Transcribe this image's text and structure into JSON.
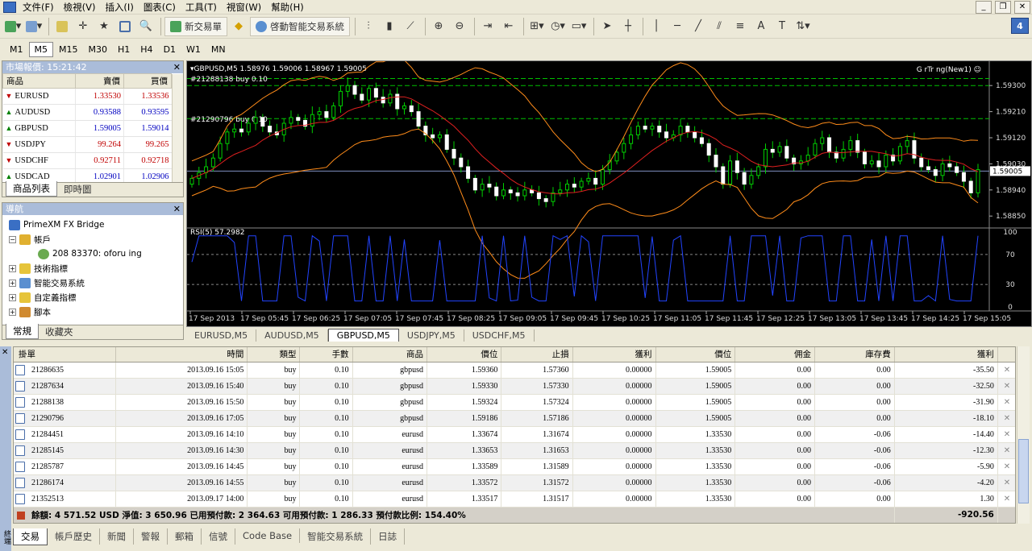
{
  "menu": [
    "文件(F)",
    "檢視(V)",
    "插入(I)",
    "圖表(C)",
    "工具(T)",
    "視窗(W)",
    "幫助(H)"
  ],
  "toolbar": {
    "new_order": "新交易單",
    "auto_trading": "啓動智能交易系統",
    "badge": "4"
  },
  "timeframes": [
    "M1",
    "M5",
    "M15",
    "M30",
    "H1",
    "H4",
    "D1",
    "W1",
    "MN"
  ],
  "active_timeframe": "M5",
  "market_watch": {
    "title": "市場報價: 15:21:42",
    "headers": [
      "商品",
      "賣價",
      "買價"
    ],
    "rows": [
      {
        "symbol": "EURUSD",
        "bid": "1.33530",
        "ask": "1.33536",
        "dir": "down"
      },
      {
        "symbol": "AUDUSD",
        "bid": "0.93588",
        "ask": "0.93595",
        "dir": "up"
      },
      {
        "symbol": "GBPUSD",
        "bid": "1.59005",
        "ask": "1.59014",
        "dir": "up"
      },
      {
        "symbol": "USDJPY",
        "bid": "99.264",
        "ask": "99.265",
        "dir": "down"
      },
      {
        "symbol": "USDCHF",
        "bid": "0.92711",
        "ask": "0.92718",
        "dir": "down"
      },
      {
        "symbol": "USDCAD",
        "bid": "1.02901",
        "ask": "1.02906",
        "dir": "up"
      }
    ],
    "tabs": [
      "商品列表",
      "即時圖"
    ]
  },
  "navigator": {
    "title": "導航",
    "root": "PrimeXM FX Bridge",
    "accounts": "帳戶",
    "account_item": "208   83370:   oforu   ing",
    "items": [
      "技術指標",
      "智能交易系統",
      "自定義指標",
      "腳本"
    ],
    "tabs": [
      "常規",
      "收藏夾"
    ]
  },
  "chart": {
    "header": "GBPUSD,M5  1.58976 1.59006 1.58967 1.59005",
    "ea_label": "G  rTr   ng(New1)",
    "order1": "#21288138 buy 0.10",
    "order2": "#21290796 buy 0.10",
    "price_labels": [
      "1.59300",
      "1.59210",
      "1.59120",
      "1.59030",
      "1.59005",
      "1.58940",
      "1.58850"
    ],
    "rsi_label": "RSI(5) 57.2982",
    "rsi_levels": [
      "100",
      "70",
      "30",
      "0"
    ],
    "time_labels": [
      "17 Sep 2013",
      "17 Sep 05:45",
      "17 Sep 06:25",
      "17 Sep 07:05",
      "17 Sep 07:45",
      "17 Sep 08:25",
      "17 Sep 09:05",
      "17 Sep 09:45",
      "17 Sep 10:25",
      "17 Sep 11:05",
      "17 Sep 11:45",
      "17 Sep 12:25",
      "17 Sep 13:05",
      "17 Sep 13:45",
      "17 Sep 14:25",
      "17 Sep 15:05"
    ]
  },
  "chart_tabs": [
    "EURUSD,M5",
    "AUDUSD,M5",
    "GBPUSD,M5",
    "USDJPY,M5",
    "USDCHF,M5"
  ],
  "active_chart_tab": "GBPUSD,M5",
  "terminal": {
    "side_title": "終端",
    "headers": [
      "掛單",
      "時間",
      "類型",
      "手數",
      "商品",
      "價位",
      "止損",
      "獲利",
      "價位",
      "佣金",
      "庫存費",
      "獲利"
    ],
    "rows": [
      [
        "21286635",
        "2013.09.16 15:05",
        "buy",
        "0.10",
        "gbpusd",
        "1.59360",
        "1.57360",
        "0.00000",
        "1.59005",
        "0.00",
        "0.00",
        "-35.50"
      ],
      [
        "21287634",
        "2013.09.16 15:40",
        "buy",
        "0.10",
        "gbpusd",
        "1.59330",
        "1.57330",
        "0.00000",
        "1.59005",
        "0.00",
        "0.00",
        "-32.50"
      ],
      [
        "21288138",
        "2013.09.16 15:50",
        "buy",
        "0.10",
        "gbpusd",
        "1.59324",
        "1.57324",
        "0.00000",
        "1.59005",
        "0.00",
        "0.00",
        "-31.90"
      ],
      [
        "21290796",
        "2013.09.16 17:05",
        "buy",
        "0.10",
        "gbpusd",
        "1.59186",
        "1.57186",
        "0.00000",
        "1.59005",
        "0.00",
        "0.00",
        "-18.10"
      ],
      [
        "21284451",
        "2013.09.16 14:10",
        "buy",
        "0.10",
        "eurusd",
        "1.33674",
        "1.31674",
        "0.00000",
        "1.33530",
        "0.00",
        "-0.06",
        "-14.40"
      ],
      [
        "21285145",
        "2013.09.16 14:30",
        "buy",
        "0.10",
        "eurusd",
        "1.33653",
        "1.31653",
        "0.00000",
        "1.33530",
        "0.00",
        "-0.06",
        "-12.30"
      ],
      [
        "21285787",
        "2013.09.16 14:45",
        "buy",
        "0.10",
        "eurusd",
        "1.33589",
        "1.31589",
        "0.00000",
        "1.33530",
        "0.00",
        "-0.06",
        "-5.90"
      ],
      [
        "21286174",
        "2013.09.16 14:55",
        "buy",
        "0.10",
        "eurusd",
        "1.33572",
        "1.31572",
        "0.00000",
        "1.33530",
        "0.00",
        "-0.06",
        "-4.20"
      ],
      [
        "21352513",
        "2013.09.17 14:00",
        "buy",
        "0.10",
        "eurusd",
        "1.33517",
        "1.31517",
        "0.00000",
        "1.33530",
        "0.00",
        "0.00",
        "1.30"
      ]
    ],
    "summary": "餘額: 4 571.52 USD  淨值: 3 650.96  已用預付款: 2 364.63  可用預付款: 1 286.33  預付款比例: 154.40%",
    "summary_total": "-920.56",
    "tabs": [
      "交易",
      "帳戶歷史",
      "新聞",
      "警報",
      "郵箱",
      "信號",
      "Code Base",
      "智能交易系統",
      "日誌"
    ]
  },
  "colors": {
    "up": "#008000",
    "down": "#c00000",
    "candle": "#00d000",
    "band": "#ff8c1a",
    "ma": "#e02020",
    "rsi": "#2244ff",
    "grid": "#606060"
  }
}
